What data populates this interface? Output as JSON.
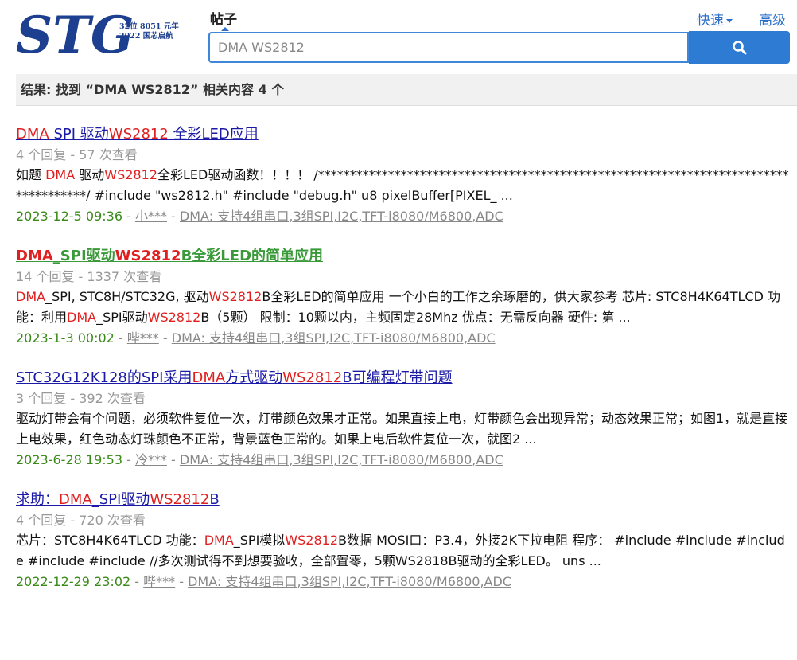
{
  "header": {
    "logo_text": "STG",
    "logo_sub_line1": "32位 8051 元年",
    "logo_sub_line2": "2022 国芯启航",
    "tab_label": "帖子",
    "quick_label": "快速",
    "advanced_label": "高级",
    "search_value": "DMA WS2812",
    "search_icon": "search-icon"
  },
  "summary": {
    "text": "结果: 找到 “DMA WS2812” 相关内容 4 个"
  },
  "colors": {
    "link": "#1a1aa6",
    "visited_link": "#3a9a3a",
    "highlight": "#e02020",
    "date": "#3a8a1a",
    "button": "#2d7bd2"
  },
  "results": [
    {
      "title": [
        [
          "DMA",
          true
        ],
        [
          " SPI 驱动",
          false
        ],
        [
          "WS2812",
          true
        ],
        [
          " 全彩LED应用",
          false
        ]
      ],
      "meta": "4 个回复 - 57 次查看",
      "snippet": [
        [
          "如题 ",
          false
        ],
        [
          "DMA",
          true
        ],
        [
          " 驱动",
          false
        ],
        [
          "WS2812",
          true
        ],
        [
          "全彩LED驱动函数！！！！ /*************************************************************************************/ #include \"ws2812.h\" #include \"debug.h\" u8 pixelBuffer[PIXEL_ ...",
          false
        ]
      ],
      "date": "2023-12-5 09:36",
      "author": "小***",
      "forum": "DMA: 支持4组串口,3组SPI,I2C,TFT-i8080/M6800,ADC"
    },
    {
      "title": [
        [
          "DMA",
          true
        ],
        [
          "_SPI驱动",
          false
        ],
        [
          "WS2812",
          true
        ],
        [
          "B全彩LED的简单应用",
          false
        ]
      ],
      "meta": "14 个回复 - 1337 次查看",
      "snippet": [
        [
          "DMA",
          true
        ],
        [
          "_SPI, STC8H/STC32G, 驱动",
          false
        ],
        [
          "WS2812",
          true
        ],
        [
          "B全彩LED的简单应用 一个小白的工作之余琢磨的，供大家参考 芯片: STC8H4K64TLCD 功能：利用",
          false
        ],
        [
          "DMA",
          true
        ],
        [
          "_SPI驱动",
          false
        ],
        [
          "WS2812",
          true
        ],
        [
          "B（5颗） 限制：10颗以内，主频固定28Mhz 优点：无需反向器 硬件: 第 ...",
          false
        ]
      ],
      "date": "2023-1-3 00:02",
      "author": "哔***",
      "forum": "DMA: 支持4组串口,3组SPI,I2C,TFT-i8080/M6800,ADC"
    },
    {
      "title": [
        [
          "STC32G12K128的SPI采用",
          false
        ],
        [
          "DMA",
          true
        ],
        [
          "方式驱动",
          false
        ],
        [
          "WS2812",
          true
        ],
        [
          "B可编程灯带问题",
          false
        ]
      ],
      "meta": "3 个回复 - 392 次查看",
      "snippet": [
        [
          "驱动灯带会有个问题，必须软件复位一次，灯带颜色效果才正常。如果直接上电，灯带颜色会出现异常；动态效果正常；如图1，就是直接上电效果，红色动态灯珠颜色不正常，背景蓝色正常的。如果上电后软件复位一次，就图2 ...",
          false
        ]
      ],
      "date": "2023-6-28 19:53",
      "author": "冷***",
      "forum": "DMA: 支持4组串口,3组SPI,I2C,TFT-i8080/M6800,ADC"
    },
    {
      "title": [
        [
          "求助：",
          false
        ],
        [
          "DMA",
          true
        ],
        [
          "_SPI驱动",
          false
        ],
        [
          "WS2812",
          true
        ],
        [
          "B",
          false
        ]
      ],
      "meta": "4 个回复 - 720 次查看",
      "snippet": [
        [
          "芯片：STC8H4K64TLCD 功能：",
          false
        ],
        [
          "DMA",
          true
        ],
        [
          "_SPI模拟",
          false
        ],
        [
          "WS2812",
          true
        ],
        [
          "B数据 MOSI口：P3.4，外接2K下拉电阻 程序： #include #include #include #include #include //多次测试得不到想要验收，全部置零，5颗WS2818B驱动的全彩LED。 uns ...",
          false
        ]
      ],
      "date": "2022-12-29 23:02",
      "author": "哔***",
      "forum": "DMA: 支持4组串口,3组SPI,I2C,TFT-i8080/M6800,ADC"
    }
  ]
}
